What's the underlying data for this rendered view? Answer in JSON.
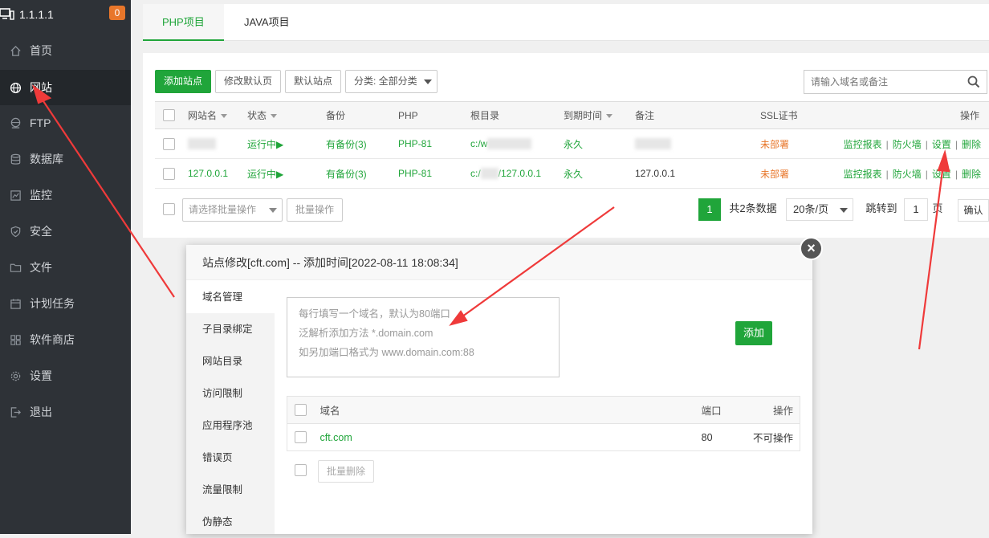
{
  "sidebar": {
    "ip": "1.1.1.1",
    "badge": "0",
    "items": [
      {
        "label": "首页",
        "icon": "home-icon"
      },
      {
        "label": "网站",
        "icon": "globe-icon"
      },
      {
        "label": "FTP",
        "icon": "ftp-icon"
      },
      {
        "label": "数据库",
        "icon": "database-icon"
      },
      {
        "label": "监控",
        "icon": "monitor-icon"
      },
      {
        "label": "安全",
        "icon": "shield-icon"
      },
      {
        "label": "文件",
        "icon": "folder-icon"
      },
      {
        "label": "计划任务",
        "icon": "calendar-icon"
      },
      {
        "label": "软件商店",
        "icon": "apps-icon"
      },
      {
        "label": "设置",
        "icon": "gear-icon"
      },
      {
        "label": "退出",
        "icon": "logout-icon"
      }
    ]
  },
  "tabs": [
    {
      "label": "PHP项目"
    },
    {
      "label": "JAVA项目"
    }
  ],
  "toolbar": {
    "add_site": "添加站点",
    "edit_default": "修改默认页",
    "default_site": "默认站点",
    "category": "分类: 全部分类",
    "search_placeholder": "请输入域名或备注"
  },
  "table": {
    "headers": {
      "name": "网站名",
      "status": "状态",
      "backup": "备份",
      "php": "PHP",
      "root": "根目录",
      "expire": "到期时间",
      "remark": "备注",
      "ssl": "SSL证书",
      "ops": "操作"
    },
    "rows": [
      {
        "name": "",
        "status": "运行中▶",
        "backup": "有备份(3)",
        "php": "PHP-81",
        "root": "c:/w",
        "expire": "永久",
        "remark": "",
        "ssl": "未部署",
        "op_report": "监控报表",
        "op_firewall": "防火墙",
        "op_settings": "设置",
        "op_delete": "删除"
      },
      {
        "name": "127.0.0.1",
        "status": "运行中▶",
        "backup": "有备份(3)",
        "php": "PHP-81",
        "root_prefix": "c:/",
        "root_suffix": "/127.0.0.1",
        "expire": "永久",
        "remark": "127.0.0.1",
        "ssl": "未部署",
        "op_report": "监控报表",
        "op_firewall": "防火墙",
        "op_settings": "设置",
        "op_delete": "删除"
      }
    ],
    "op_separator": "|"
  },
  "bulk": {
    "select_placeholder": "请选择批量操作",
    "action": "批量操作"
  },
  "pager": {
    "current": "1",
    "total": "共2条数据",
    "per_page": "20条/页",
    "jump": "跳转到",
    "jump_value": "1",
    "page_unit": "页",
    "confirm": "确认"
  },
  "modal": {
    "title": "站点修改[cft.com] -- 添加时间[2022-08-11 18:08:34]",
    "close": "×",
    "nav": [
      "域名管理",
      "子目录绑定",
      "网站目录",
      "访问限制",
      "应用程序池",
      "错误页",
      "流量限制",
      "伪静态"
    ],
    "placeholder_lines": [
      "每行填写一个域名，默认为80端口",
      "泛解析添加方法 *.domain.com",
      "如另加端口格式为 www.domain.com:88"
    ],
    "add_button": "添加",
    "domain_table": {
      "headers": {
        "domain": "域名",
        "port": "端口",
        "ops": "操作"
      },
      "rows": [
        {
          "domain": "cft.com",
          "port": "80",
          "ops": "不可操作"
        }
      ]
    },
    "bulk_delete": "批量删除"
  },
  "colors": {
    "accent": "#20a53a",
    "sidebar_bg": "#2e3237",
    "warning": "#e8762a",
    "annotation_arrow": "#ef3a3a"
  }
}
